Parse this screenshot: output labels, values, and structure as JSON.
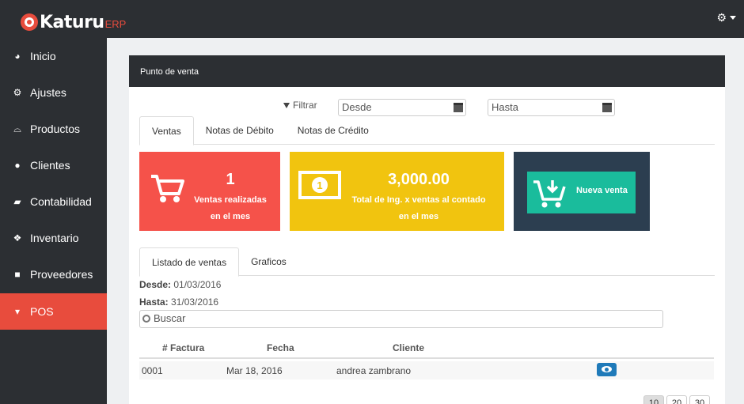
{
  "app": {
    "logo": "Katuru",
    "logo_suffix": "ERP",
    "settings_icon": "gear-icon"
  },
  "sidebar": {
    "items": [
      {
        "label": "Inicio",
        "icon": "dashboard-icon"
      },
      {
        "label": "Ajustes",
        "icon": "gears-icon"
      },
      {
        "label": "Productos",
        "icon": "basket-icon"
      },
      {
        "label": "Clientes",
        "icon": "users-icon"
      },
      {
        "label": "Contabilidad",
        "icon": "book-icon"
      },
      {
        "label": "Inventario",
        "icon": "cubes-icon"
      },
      {
        "label": "Proveedores",
        "icon": "truck-icon"
      },
      {
        "label": "POS",
        "icon": "cart-icon"
      }
    ],
    "active": "POS"
  },
  "panel": {
    "title": "Punto de venta"
  },
  "filter": {
    "label": "Filtrar",
    "desde_placeholder": "Desde",
    "hasta_placeholder": "Hasta"
  },
  "tabs_top": [
    "Ventas",
    "Notas de Débito",
    "Notas de Crédito"
  ],
  "cards": {
    "ventas": {
      "value": "1",
      "label_1": "Ventas realizadas",
      "label_2": "en el mes",
      "color": "#f5524a"
    },
    "total": {
      "value": "3,000.00",
      "label_1": "Total de Ing. x ventas al contado",
      "label_2": "en el mes",
      "color": "#f1c40f"
    },
    "nueva": {
      "label": "Nueva venta",
      "color": "#2c3e50",
      "button_color": "#1abc9c"
    }
  },
  "tabs_bottom": [
    "Listado de ventas",
    "Graficos"
  ],
  "range": {
    "desde_label": "Desde:",
    "desde_value": "01/03/2016",
    "hasta_label": "Hasta:",
    "hasta_value": "31/03/2016"
  },
  "search": {
    "placeholder": "Buscar"
  },
  "table": {
    "headers": [
      "# Factura",
      "Fecha",
      "Cliente"
    ],
    "rows": [
      {
        "factura": "0001",
        "fecha": "Mar 18, 2016",
        "cliente": "andrea zambrano"
      }
    ]
  },
  "pagination": [
    "10",
    "20",
    "30"
  ]
}
